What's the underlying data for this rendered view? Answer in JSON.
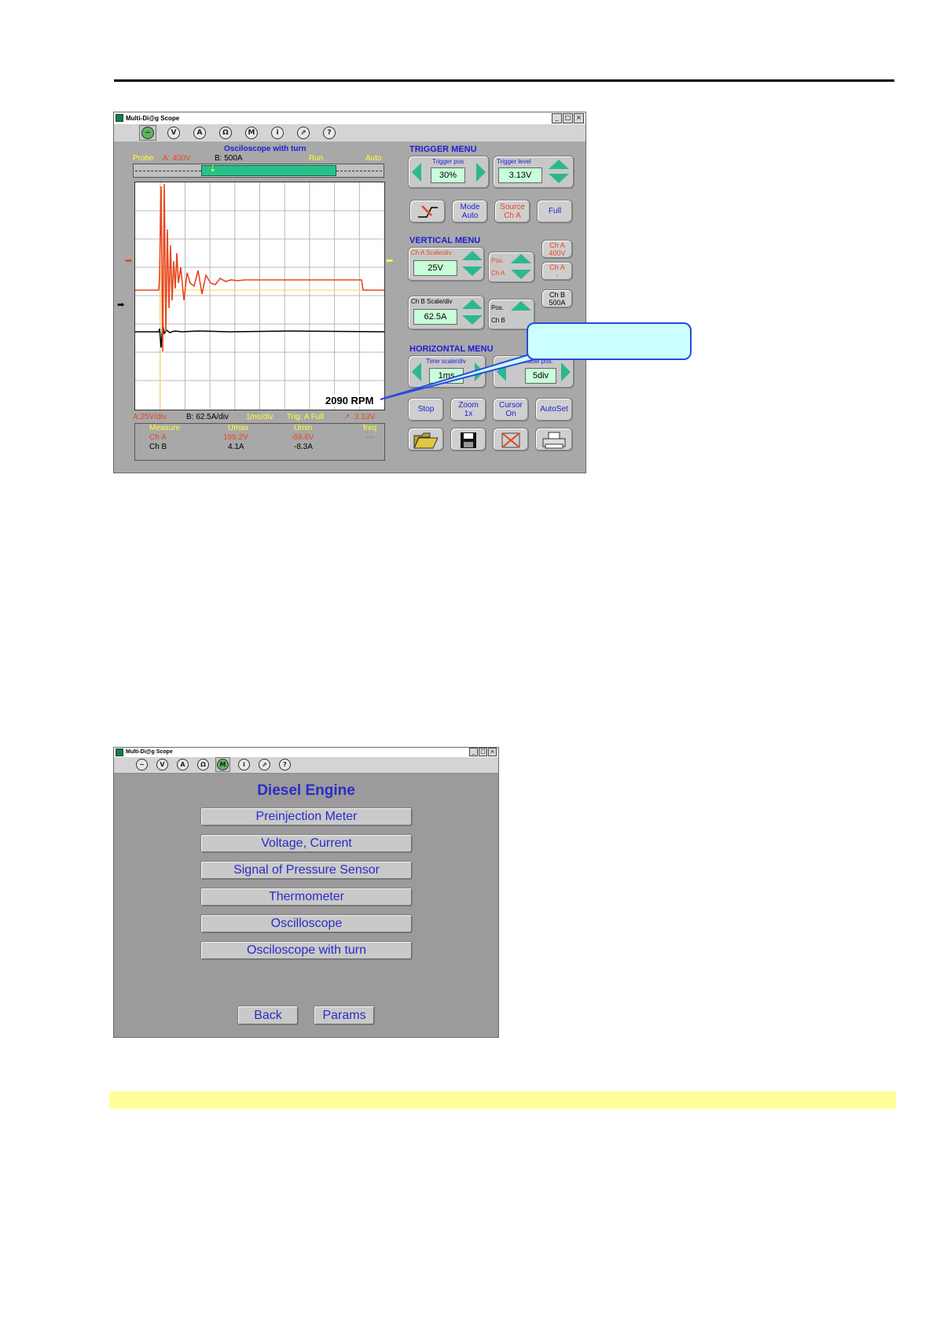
{
  "window_title": "Multi-Di@g Scope",
  "window_buttons": [
    "_",
    "□",
    "×"
  ],
  "toolbar_icons": [
    {
      "name": "oscilloscope-icon",
      "glyph": "~"
    },
    {
      "name": "voltmeter-icon",
      "glyph": "V"
    },
    {
      "name": "ammeter-icon",
      "glyph": "A"
    },
    {
      "name": "ohmmeter-icon",
      "glyph": "Ω"
    },
    {
      "name": "menu-icon",
      "glyph": "M"
    },
    {
      "name": "info-icon",
      "glyph": "i"
    },
    {
      "name": "export-icon",
      "glyph": "⇗"
    },
    {
      "name": "help-icon",
      "glyph": "?"
    }
  ],
  "scope": {
    "header_title": "Osciloscope with turn",
    "probe_label": "Probe",
    "probe_a": "A: 400V",
    "probe_b": "B: 500A",
    "run_status": "Run",
    "trigger_mode": "Auto",
    "rpm": "2090  RPM",
    "status_a": "A:25V/div",
    "status_b": "B: 62.5A/div",
    "status_time": "1ms/div",
    "status_trig": "Trig: A  Full",
    "status_level": "3.13V",
    "measure": {
      "headers": [
        "Measure",
        "Umax",
        "Umin",
        "freq"
      ],
      "rows": [
        {
          "ch": "Ch A",
          "umax": "199.2V",
          "umin": "-69.6V",
          "freq": "---"
        },
        {
          "ch": "Ch B",
          "umax": "4.1A",
          "umin": "-8.3A",
          "freq": ""
        }
      ]
    },
    "trigger_menu": {
      "title": "TRIGGER MENU",
      "pos_label": "Trigger pos",
      "pos_value": "30%",
      "level_label": "Trigger level",
      "level_value": "3.13V",
      "mode_label": "Mode",
      "mode_value": "Auto",
      "source_label": "Source",
      "source_value": "Ch A",
      "full_label": "Full"
    },
    "vertical_menu": {
      "title": "VERTICAL MENU",
      "cha_scale_label": "Ch A Scale/div",
      "cha_scale_value": "25V",
      "cha_pos_label1": "Pos.",
      "cha_pos_label2": "Ch A",
      "cha_probe_1": "Ch A",
      "cha_probe_2": "400V",
      "cha_inv_1": "Ch A",
      "cha_inv_2": "-",
      "chb_scale_label": "Ch B Scale/div",
      "chb_scale_value": "62.5A",
      "chb_pos_label1": "Pos.",
      "chb_pos_label2": "Ch B",
      "chb_probe_1": "Ch B",
      "chb_probe_2": "500A"
    },
    "horizontal_menu": {
      "title": "HORIZONTAL MENU",
      "time_label": "Time scale/div",
      "time_value": "1ms",
      "window_label": "Window pos.",
      "window_value": "5div"
    },
    "actions": {
      "stop": "Stop",
      "zoom_1": "Zoom",
      "zoom_2": "1x",
      "cursor_1": "Cursor",
      "cursor_2": "On",
      "autoset": "AutoSet"
    }
  },
  "diesel": {
    "title": "Diesel Engine",
    "items": [
      "Preinjection Meter",
      "Voltage, Current",
      "Signal of Pressure Sensor",
      "Thermometer",
      "Oscilloscope",
      "Osciloscope with turn"
    ],
    "back": "Back",
    "params": "Params"
  }
}
